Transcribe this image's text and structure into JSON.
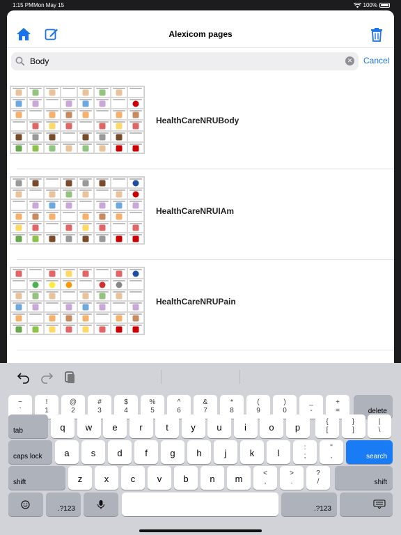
{
  "status": {
    "time": "1:15 PM",
    "date": "Mon May 15",
    "battery": "100%"
  },
  "nav": {
    "title": "Alexicom pages",
    "home_icon": "home-icon",
    "compose_icon": "compose-icon",
    "trash_icon": "trash-icon",
    "accent": "#1a73e8"
  },
  "search": {
    "value": "Body",
    "cancel_label": "Cancel"
  },
  "results": [
    {
      "title": "HealthCareNRUBody"
    },
    {
      "title": "HealthCareNRUIAm"
    },
    {
      "title": "HealthCareNRUPain"
    }
  ],
  "keyboard": {
    "row1": [
      {
        "top": "~",
        "bot": "`"
      },
      {
        "top": "!",
        "bot": "1"
      },
      {
        "top": "@",
        "bot": "2"
      },
      {
        "top": "#",
        "bot": "3"
      },
      {
        "top": "$",
        "bot": "4"
      },
      {
        "top": "%",
        "bot": "5"
      },
      {
        "top": "^",
        "bot": "6"
      },
      {
        "top": "&",
        "bot": "7"
      },
      {
        "top": "*",
        "bot": "8"
      },
      {
        "top": "(",
        "bot": "9"
      },
      {
        "top": ")",
        "bot": "0"
      },
      {
        "top": "_",
        "bot": "-"
      },
      {
        "top": "+",
        "bot": "="
      }
    ],
    "delete_label": "delete",
    "tab_label": "tab",
    "row2": [
      "q",
      "w",
      "e",
      "r",
      "t",
      "y",
      "u",
      "i",
      "o",
      "p"
    ],
    "row2_extra": [
      {
        "top": "{",
        "bot": "["
      },
      {
        "top": "}",
        "bot": "]"
      },
      {
        "top": "|",
        "bot": "\\"
      }
    ],
    "caps_label": "caps lock",
    "row3": [
      "a",
      "s",
      "d",
      "f",
      "g",
      "h",
      "j",
      "k",
      "l"
    ],
    "row3_extra": [
      {
        "top": ":",
        "bot": ";"
      },
      {
        "top": "\"",
        "bot": ","
      }
    ],
    "search_label": "search",
    "shift_label": "shift",
    "row4": [
      "z",
      "x",
      "c",
      "v",
      "b",
      "n",
      "m"
    ],
    "row4_extra": [
      {
        "top": "<",
        "bot": ","
      },
      {
        "top": ">",
        "bot": "."
      },
      {
        "top": "?",
        "bot": "/"
      }
    ],
    "numeric_label": ".?123"
  }
}
